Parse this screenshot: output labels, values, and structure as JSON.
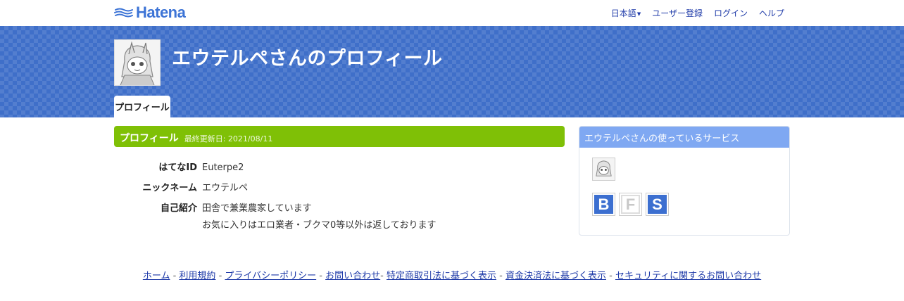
{
  "header": {
    "logo_text": "Hatena",
    "nav": {
      "language": "日本語",
      "register": "ユーザー登録",
      "login": "ログイン",
      "help": "ヘルプ"
    }
  },
  "profile_header": {
    "title": "エウテルペさんのプロフィール",
    "tab_label": "プロフィール"
  },
  "profile": {
    "section_title": "プロフィール",
    "last_updated": "最終更新日: 2021/08/11",
    "rows": [
      {
        "label": "はてなID",
        "value": "Euterpe2"
      },
      {
        "label": "ニックネーム",
        "value": "エウテルペ"
      },
      {
        "label": "自己紹介",
        "value_line1": "田舎で兼業農家しています",
        "value_line2": "お気に入りはエロ業者・ブクマ0等以外は返しております"
      }
    ]
  },
  "services": {
    "title": "エウテルペさんの使っているサービス",
    "icons": [
      {
        "letter": "B",
        "name": "hatena-bookmark-icon",
        "color": "#3c6fd0"
      },
      {
        "letter": "F",
        "name": "hatena-fotolife-icon",
        "color": "#c8c8c8"
      },
      {
        "letter": "S",
        "name": "hatena-star-icon",
        "color": "#3c6fd0"
      }
    ]
  },
  "footer": {
    "links": [
      "ホーム",
      "利用規約",
      "プライバシーポリシー",
      "お問い合わせ",
      "特定商取引法に基づく表示",
      "資金決済法に基づく表示",
      "セキュリティに関するお問い合わせ"
    ],
    "separator": " - "
  },
  "colors": {
    "brand_blue": "#3d74d6",
    "band_blue": "#3f6fc9",
    "profile_green": "#7fc006",
    "services_head": "#7fa8f2",
    "link": "#1e3aa8"
  }
}
